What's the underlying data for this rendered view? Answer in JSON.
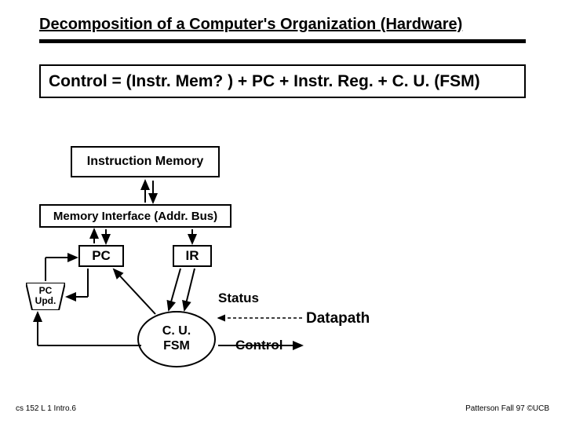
{
  "title": "Decomposition of a Computer's Organization (Hardware)",
  "equation": "Control =  (Instr. Mem? ) + PC + Instr. Reg. + C. U. (FSM)",
  "blocks": {
    "instr_mem": "Instruction Memory",
    "mem_if": "Memory Interface (Addr. Bus)",
    "pc": "PC",
    "ir": "IR",
    "pc_upd_line1": "PC",
    "pc_upd_line2": "Upd.",
    "cu_line1": "C. U.",
    "cu_line2": "FSM"
  },
  "labels": {
    "status": "Status",
    "datapath": "Datapath",
    "control": "Control"
  },
  "footer": {
    "left": "cs 152 L 1 Intro.6",
    "right": "Patterson Fall 97 ©UCB"
  }
}
